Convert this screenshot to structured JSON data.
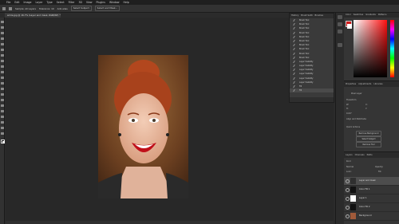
{
  "menubar": {
    "items": [
      "File",
      "Edit",
      "Image",
      "Layer",
      "Type",
      "Select",
      "Filter",
      "3D",
      "View",
      "Plugins",
      "Window",
      "Help"
    ]
  },
  "options_bar": {
    "items": [
      "Sample: All Layers",
      "Tolerance: 10",
      "Anti-alias",
      "Select Subject",
      "Select and Mask..."
    ]
  },
  "document": {
    "tab_title": "smile.jpg @ 16.7% (Layer and mask, RGB/8#) *"
  },
  "history_panel": {
    "tabs": [
      "History",
      "Brush Setti",
      "Brushes"
    ],
    "steps": [
      "Brush Tool",
      "Brush Tool",
      "Brush Tool",
      "Brush Tool",
      "Brush Tool",
      "Brush Tool",
      "Brush Tool",
      "Brush Tool",
      "Brush Tool",
      "Brush Tool",
      "Layer Visibility",
      "Layer Visibility",
      "Layer Visibility",
      "Layer Visibility",
      "Layer Visibility",
      "Layer Visibility",
      "Fill",
      "Fill"
    ],
    "selected_index": 17
  },
  "color_panel": {
    "tabs": [
      "Color",
      "Swatches",
      "Gradients",
      "Patterns"
    ],
    "foreground": "#d11a1a",
    "background": "#ffffff"
  },
  "properties_panel": {
    "tabs": [
      "Properties",
      "Adjustments",
      "Libraries"
    ],
    "section": "Pixel Layer",
    "subsection": "Transform",
    "w_label": "W:",
    "h_label": "H:",
    "x_label": "X:",
    "y_label": "Y:",
    "angle_label": "0.00°",
    "align_label": "Align and Distribute",
    "quick_actions_label": "Quick Actions",
    "buttons": [
      "Remove Background",
      "Select Subject",
      "Remove Tool"
    ]
  },
  "layers_panel": {
    "tabs": [
      "Layers",
      "Channels",
      "Paths"
    ],
    "search_placeholder": "Kind",
    "blend_mode": "Normal",
    "opacity_label": "Opacity:",
    "fill_label": "Fill:",
    "lock_label": "Lock:",
    "layers": [
      {
        "name": "Layer and mask",
        "selected": true,
        "thumb": "#2f2f2f"
      },
      {
        "name": "Color Fill 1",
        "selected": false,
        "thumb": "#111111"
      },
      {
        "name": "Layer 1",
        "selected": false,
        "thumb": "#ffffff"
      },
      {
        "name": "Color Fill 2",
        "selected": false,
        "thumb": "#111111"
      },
      {
        "name": "Background",
        "selected": false,
        "thumb": "#a05a3a"
      }
    ]
  }
}
